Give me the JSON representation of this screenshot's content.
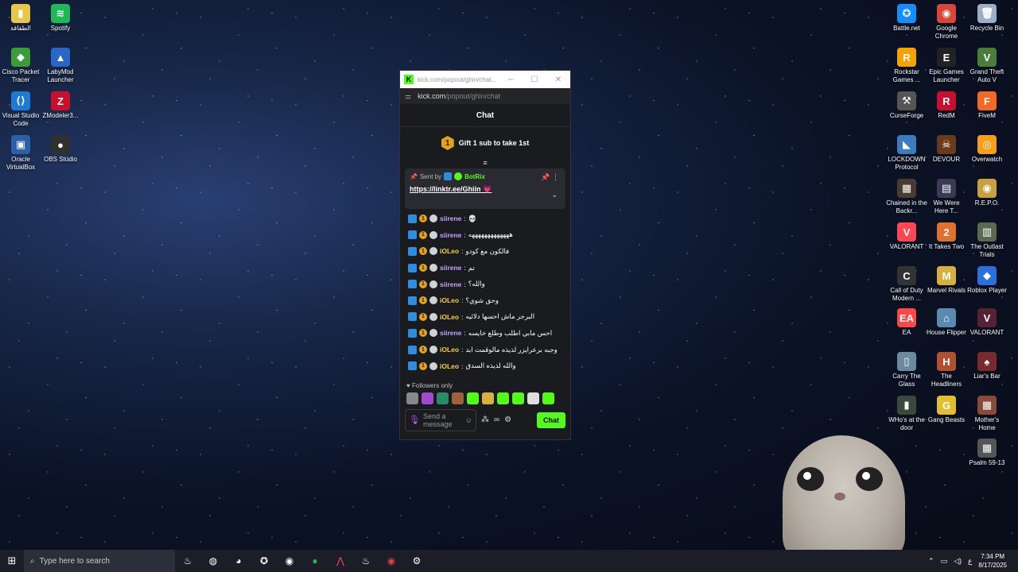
{
  "desktop": {
    "left_icons": [
      {
        "label": "الطقاقة",
        "color": "#e8c64a",
        "glyph": "▮"
      },
      {
        "label": "Spotify",
        "color": "#1db954",
        "glyph": "≋"
      },
      {
        "label": "Cisco Packet Tracer",
        "color": "#3a9d3a",
        "glyph": "◆"
      },
      {
        "label": "LabyMod Launcher",
        "color": "#2a66c8",
        "glyph": "▲"
      },
      {
        "label": "Visual Studio Code",
        "color": "#1f7ad1",
        "glyph": "⟨⟩"
      },
      {
        "label": "ZModeler3...",
        "color": "#c8102e",
        "glyph": "Z"
      },
      {
        "label": "Oracle VirtualBox",
        "color": "#2d5fa8",
        "glyph": "▣"
      },
      {
        "label": "OBS Studio",
        "color": "#303030",
        "glyph": "●"
      }
    ],
    "right_icons": [
      {
        "label": "Battle.net",
        "color": "#148eff",
        "glyph": "✪"
      },
      {
        "label": "Google Chrome",
        "color": "#db4437",
        "glyph": "◉"
      },
      {
        "label": "Recycle Bin",
        "color": "#9ab0c8",
        "glyph": "🗑"
      },
      {
        "label": "Rockstar Games ...",
        "color": "#f5a300",
        "glyph": "R"
      },
      {
        "label": "Epic Games Launcher",
        "color": "#222",
        "glyph": "E"
      },
      {
        "label": "Grand Theft Auto V",
        "color": "#4a7d3a",
        "glyph": "V"
      },
      {
        "label": "CurseForge",
        "color": "#555",
        "glyph": "⚒"
      },
      {
        "label": "RedM",
        "color": "#c8102e",
        "glyph": "R"
      },
      {
        "label": "FiveM",
        "color": "#f26a21",
        "glyph": "F"
      },
      {
        "label": "LOCKDOWN Protocol",
        "color": "#3b7bbf",
        "glyph": "◣"
      },
      {
        "label": "DEVOUR",
        "color": "#6a3a1a",
        "glyph": "☠"
      },
      {
        "label": "Overwatch",
        "color": "#f99e1a",
        "glyph": "◎"
      },
      {
        "label": "Chained in the Backr...",
        "color": "#4a3a30",
        "glyph": "▦"
      },
      {
        "label": "We Were Here T...",
        "color": "#3a3a55",
        "glyph": "▤"
      },
      {
        "label": "R.E.P.O.",
        "color": "#c8a040",
        "glyph": "◉"
      },
      {
        "label": "VALORANT",
        "color": "#ff4655",
        "glyph": "V"
      },
      {
        "label": "It Takes Two",
        "color": "#e07030",
        "glyph": "2"
      },
      {
        "label": "The Outlast Trials",
        "color": "#5a6a50",
        "glyph": "▥"
      },
      {
        "label": "Call of Duty Modern ...",
        "color": "#333",
        "glyph": "C"
      },
      {
        "label": "Marvel Rivals",
        "color": "#d8b040",
        "glyph": "M"
      },
      {
        "label": "Roblox Player",
        "color": "#2a6fdb",
        "glyph": "◆"
      },
      {
        "label": "EA",
        "color": "#ff4747",
        "glyph": "EA"
      },
      {
        "label": "House Flipper",
        "color": "#5a8ab0",
        "glyph": "⌂"
      },
      {
        "label": "VALORANT",
        "color": "#552233",
        "glyph": "V"
      },
      {
        "label": "Carry The Glass",
        "color": "#6a8aa0",
        "glyph": "▯"
      },
      {
        "label": "The Headliners",
        "color": "#b05030",
        "glyph": "H"
      },
      {
        "label": "Liar's Bar",
        "color": "#7a2a2a",
        "glyph": "♠"
      },
      {
        "label": "WHo's at the door",
        "color": "#3a4a3a",
        "glyph": "▮"
      },
      {
        "label": "Gang Beasts",
        "color": "#e0c030",
        "glyph": "G"
      },
      {
        "label": "Mother's Home",
        "color": "#8a4a3a",
        "glyph": "▦"
      },
      {
        "label": "Psalm 59-13",
        "color": "#555",
        "glyph": "▦"
      }
    ]
  },
  "window": {
    "title": "kick.com/popout/ghin/chat...",
    "url_host": "kick.com",
    "url_path": "/popout/ghin/chat",
    "header": "Chat",
    "gift_text": "Gift 1 sub to take 1st",
    "gift_badge": "1",
    "collapse_icon": "≡",
    "pinned": {
      "sent_by": "Sent by",
      "bot_name": "BotRix",
      "link": "https://linktr.ee/Ghiin",
      "emoji": "💗"
    },
    "messages": [
      {
        "user": "siirene",
        "color": "#c8a0ff",
        "text": "💀"
      },
      {
        "user": "siirene",
        "color": "#c8a0ff",
        "text": "هههههههههههههه"
      },
      {
        "user": "iOLeo",
        "color": "#f5d142",
        "text": "فالكون مع كودو"
      },
      {
        "user": "siirene",
        "color": "#c8a0ff",
        "text": "تم"
      },
      {
        "user": "siirene",
        "color": "#c8a0ff",
        "text": "والله؟"
      },
      {
        "user": "iOLeo",
        "color": "#f5d142",
        "text": "وحق شوي؟"
      },
      {
        "user": "iOLeo",
        "color": "#f5d142",
        "text": "البرجر ماش احسها دلائيه"
      },
      {
        "user": "siirene",
        "color": "#c8a0ff",
        "text": "احس مابي اطلب وطلع خايسه"
      },
      {
        "user": "iOLeo",
        "color": "#f5d142",
        "text": "وجبه برعرايزر لذيذه مالوقمت ابد"
      },
      {
        "user": "iOLeo",
        "color": "#f5d142",
        "text": "والله لذيذه السدق"
      }
    ],
    "followers_label": "Followers only",
    "composer_placeholder": "Send a message",
    "chat_button": "Chat",
    "infinity": "∞"
  },
  "taskbar": {
    "search_placeholder": "Type here to search",
    "time": "7:34 PM",
    "date": "8/17/2025",
    "lang": "ع"
  }
}
